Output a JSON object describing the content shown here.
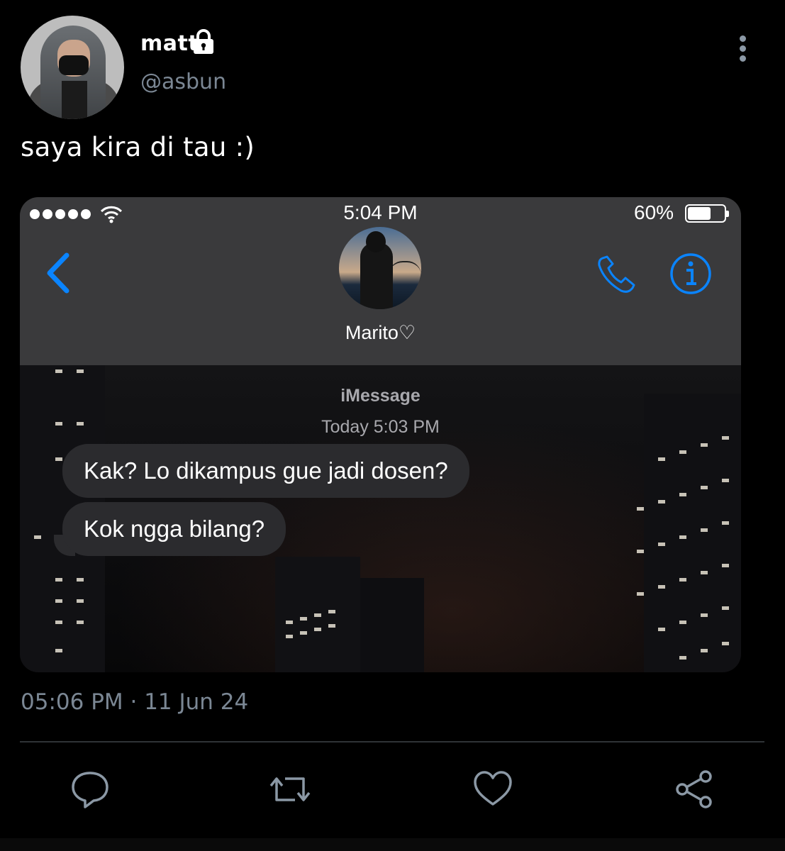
{
  "tweet": {
    "author_name": "matt",
    "author_handle": "@asbun",
    "text": "saya kira di tau :)",
    "timestamp": "05:06 PM · 11 Jun 24",
    "icons": [
      "lock-icon",
      "more-icon",
      "reply-icon",
      "retweet-icon",
      "like-icon",
      "share-icon"
    ]
  },
  "screenshot": {
    "status_time": "5:04 PM",
    "battery": "60%",
    "contact_name": "Marito♡",
    "service_label": "iMessage",
    "thread_time": "Today 5:03 PM",
    "messages": [
      {
        "text": "Kak? Lo dikampus gue jadi dosen?"
      },
      {
        "text": "Kok ngga bilang?"
      }
    ],
    "accent_color": "#0a84ff"
  }
}
